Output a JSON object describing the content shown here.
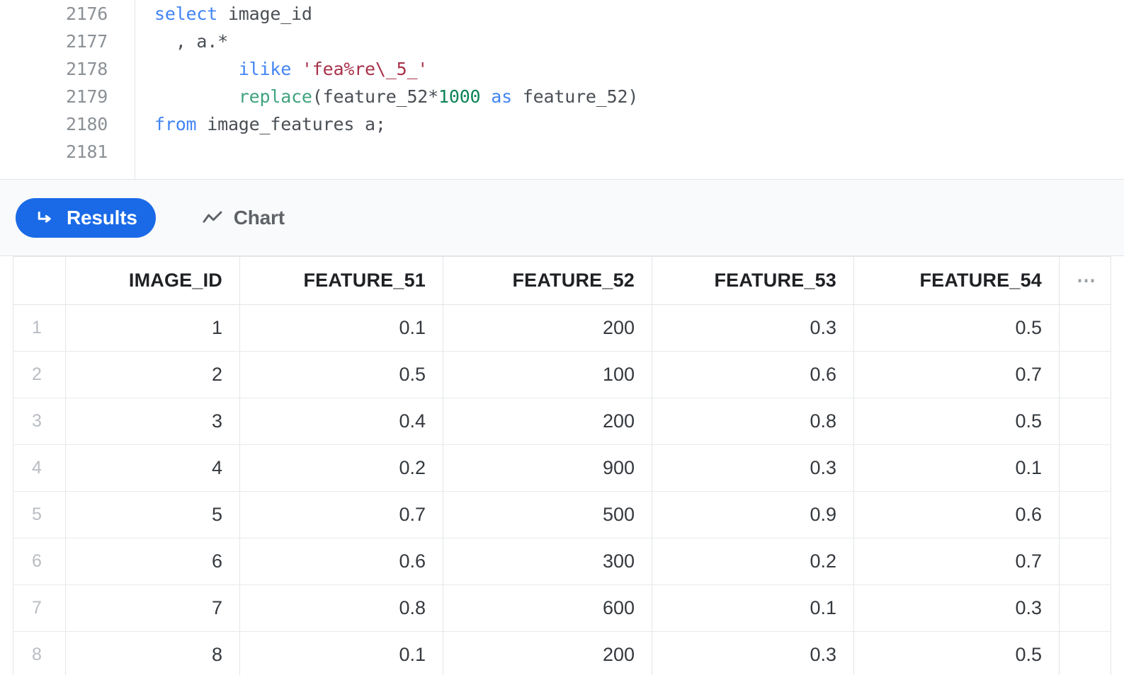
{
  "editor": {
    "line_numbers": [
      "2176",
      "2177",
      "2178",
      "2179",
      "2180",
      "2181"
    ],
    "lines": [
      {
        "indent": "",
        "tokens": [
          {
            "text": "select",
            "type": "kw"
          },
          {
            "text": " image_id",
            "type": "plain"
          }
        ]
      },
      {
        "indent": "",
        "tokens": [
          {
            "text": "  , a.*",
            "type": "plain"
          }
        ]
      },
      {
        "indent": "",
        "tokens": [
          {
            "text": "        ",
            "type": "plain"
          },
          {
            "text": "ilike",
            "type": "kw"
          },
          {
            "text": " ",
            "type": "plain"
          },
          {
            "text": "'fea%re\\_5_'",
            "type": "str"
          }
        ]
      },
      {
        "indent": "",
        "tokens": [
          {
            "text": "        ",
            "type": "plain"
          },
          {
            "text": "replace",
            "type": "fn"
          },
          {
            "text": "(feature_52*",
            "type": "plain"
          },
          {
            "text": "1000",
            "type": "num"
          },
          {
            "text": " ",
            "type": "plain"
          },
          {
            "text": "as",
            "type": "kw"
          },
          {
            "text": " feature_52)",
            "type": "plain"
          }
        ]
      },
      {
        "indent": "",
        "tokens": [
          {
            "text": "from",
            "type": "kw"
          },
          {
            "text": " image_features a;",
            "type": "plain"
          }
        ]
      },
      {
        "indent": "",
        "tokens": []
      }
    ],
    "full_sql": "select image_id\n  , a.*\n        ilike 'fea%re\\_5_'\n        replace(feature_52*1000 as feature_52)\nfrom image_features a;\n"
  },
  "tabs": [
    {
      "id": "results",
      "label": "Results",
      "icon": "return-arrow-icon",
      "active": true
    },
    {
      "id": "chart",
      "label": "Chart",
      "icon": "line-chart-icon",
      "active": false
    }
  ],
  "colors": {
    "accent": "#1a6ae8",
    "keyword": "#4285f4",
    "string": "#a8324a",
    "function": "#3fa37e",
    "number": "#0b8457",
    "code_text": "#4a4f55",
    "gutter_text": "#8c9196",
    "border": "#e3e5e8",
    "tabbar_bg": "#f9fafb"
  },
  "table": {
    "row_number_header": "",
    "more_column_label": "⋯",
    "columns": [
      "IMAGE_ID",
      "FEATURE_51",
      "FEATURE_52",
      "FEATURE_53",
      "FEATURE_54"
    ],
    "rows": [
      {
        "n": "1",
        "cells": [
          "1",
          "0.1",
          "200",
          "0.3",
          "0.5"
        ]
      },
      {
        "n": "2",
        "cells": [
          "2",
          "0.5",
          "100",
          "0.6",
          "0.7"
        ]
      },
      {
        "n": "3",
        "cells": [
          "3",
          "0.4",
          "200",
          "0.8",
          "0.5"
        ]
      },
      {
        "n": "4",
        "cells": [
          "4",
          "0.2",
          "900",
          "0.3",
          "0.1"
        ]
      },
      {
        "n": "5",
        "cells": [
          "5",
          "0.7",
          "500",
          "0.9",
          "0.6"
        ]
      },
      {
        "n": "6",
        "cells": [
          "6",
          "0.6",
          "300",
          "0.2",
          "0.7"
        ]
      },
      {
        "n": "7",
        "cells": [
          "7",
          "0.8",
          "600",
          "0.1",
          "0.3"
        ]
      },
      {
        "n": "8",
        "cells": [
          "8",
          "0.1",
          "200",
          "0.3",
          "0.5"
        ]
      }
    ]
  }
}
